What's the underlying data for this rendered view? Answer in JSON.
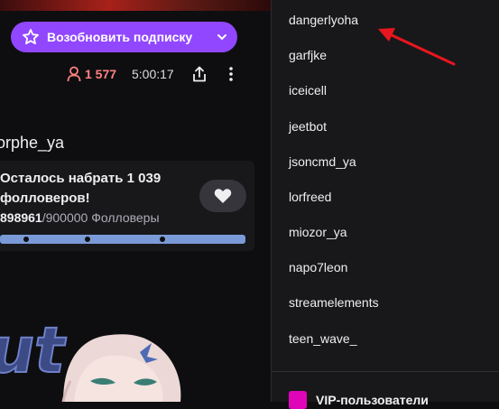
{
  "player": {
    "subscribe_label": "Возобновить подписку",
    "viewers": "1 577",
    "uptime": "5:00:17",
    "channel_name": "orphe_ya"
  },
  "goal": {
    "text": "Осталось набрать 1 039 фолловеров!",
    "current": "898961",
    "rest": "/900000 Фолловеры",
    "progress_fraction": 0.9988
  },
  "viewer_list": {
    "users": [
      "dangerlyoha",
      "garfjke",
      "iceicell",
      "jeetbot",
      "jsoncmd_ya",
      "lorfreed",
      "miozor_ya",
      "napo7leon",
      "streamelements",
      "teen_wave_"
    ],
    "vip_section_title": "VIP-пользователи"
  },
  "colors": {
    "accent": "#9147ff",
    "viewer_count": "#ff8280",
    "progress_bar": "#7b9ad8",
    "annotation_arrow": "#e8161e",
    "vip_badge": "#e005b9"
  }
}
